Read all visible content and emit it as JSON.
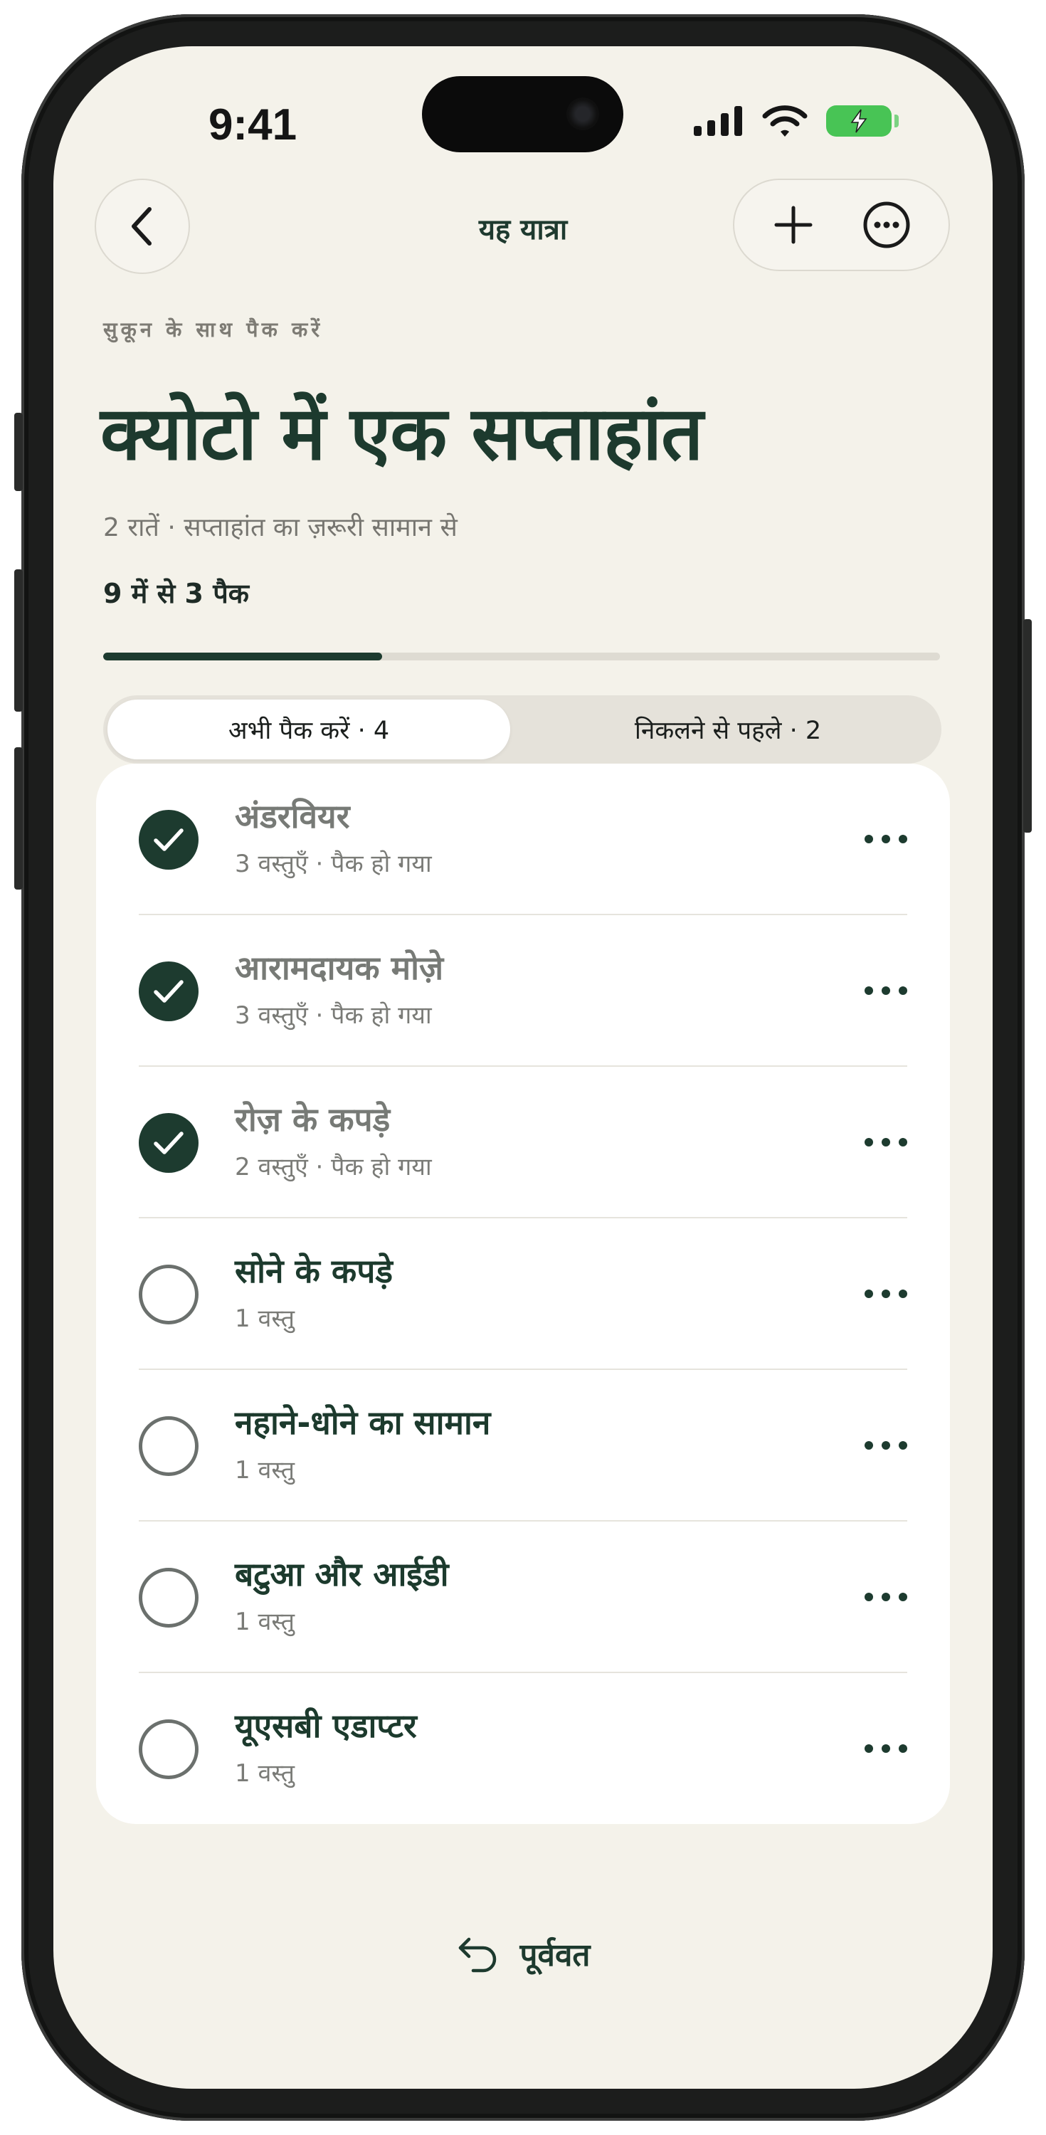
{
  "status": {
    "time": "9:41"
  },
  "nav": {
    "title": "यह यात्रा"
  },
  "header": {
    "eyebrow": "सुकून के साथ पैक करें",
    "title": "क्योटो में एक सप्ताहांत",
    "subtitle": "2 रातें · सप्ताहांत का ज़रूरी सामान से",
    "progress_text": "9 में से 3 पैक",
    "progress_fraction": 0.333
  },
  "tabs": [
    {
      "label": "अभी पैक करें · 4",
      "active": true
    },
    {
      "label": "निकलने से पहले · 2",
      "active": false
    }
  ],
  "items": [
    {
      "name": "अंडरवियर",
      "meta": "3 वस्तुएँ · पैक हो गया",
      "packed": true
    },
    {
      "name": "आरामदायक मोज़े",
      "meta": "3 वस्तुएँ · पैक हो गया",
      "packed": true
    },
    {
      "name": "रोज़ के कपड़े",
      "meta": "2 वस्तुएँ · पैक हो गया",
      "packed": true
    },
    {
      "name": "सोने के कपड़े",
      "meta": "1 वस्तु",
      "packed": false
    },
    {
      "name": "नहाने-धोने का सामान",
      "meta": "1 वस्तु",
      "packed": false
    },
    {
      "name": "बटुआ और आईडी",
      "meta": "1 वस्तु",
      "packed": false
    },
    {
      "name": "यूएसबी एडाप्टर",
      "meta": "1 वस्तु",
      "packed": false
    }
  ],
  "footer": {
    "undo_label": "पूर्ववत"
  },
  "colors": {
    "accent": "#1d3b2f",
    "background": "#f4f2ea",
    "battery": "#48c455"
  }
}
